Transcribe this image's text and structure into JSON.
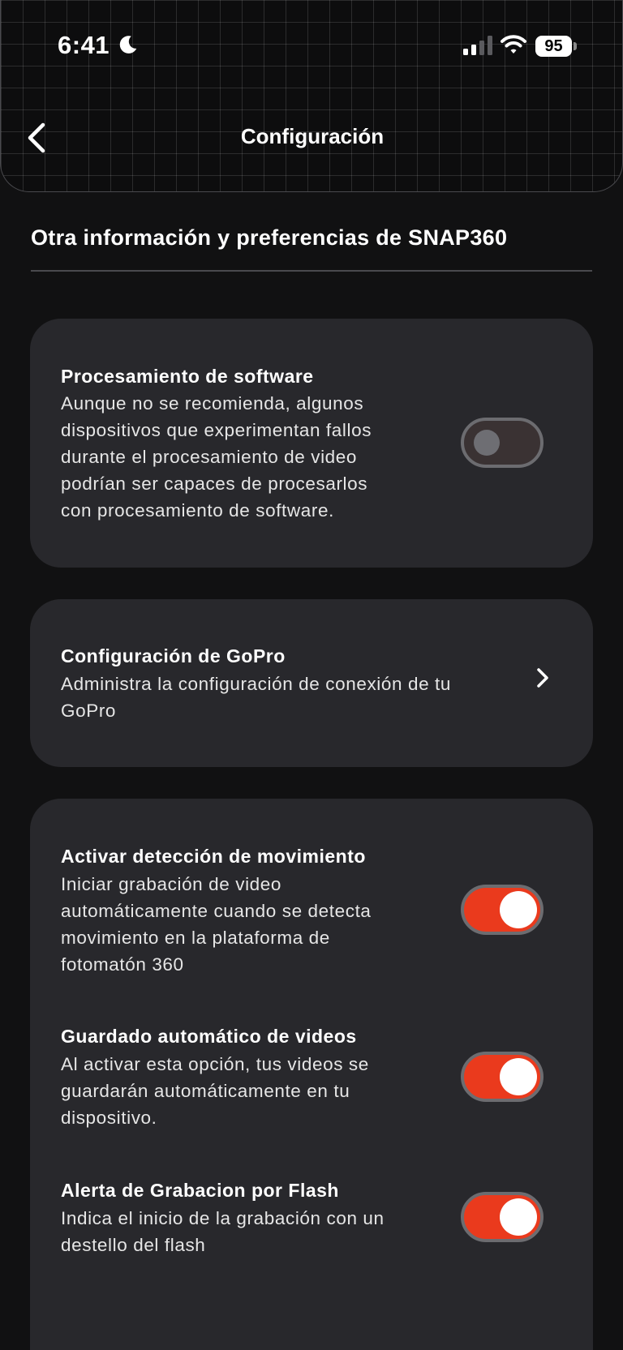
{
  "status_bar": {
    "time": "6:41",
    "battery": "95"
  },
  "header": {
    "title": "Configuración"
  },
  "section": {
    "title": "Otra información y preferencias de SNAP360"
  },
  "software_processing": {
    "title": "Procesamiento de software",
    "desc_lines": [
      "Aunque no se recomienda, algunos",
      "dispositivos que experimentan fallos",
      "durante el procesamiento de video",
      "podrían ser capaces de procesarlos",
      "con procesamiento de software."
    ],
    "enabled": false
  },
  "gopro": {
    "title": "Configuración de GoPro",
    "desc_lines": [
      "Administra la configuración de conexión de tu",
      "GoPro"
    ]
  },
  "motion_detection": {
    "title": "Activar detección de movimiento",
    "desc_lines": [
      "Iniciar grabación de video",
      "automáticamente cuando se detecta",
      "movimiento en la plataforma de",
      "fotomatón 360"
    ],
    "enabled": true
  },
  "autosave": {
    "title": "Guardado automático de videos",
    "desc_lines": [
      "Al activar esta opción, tus videos se",
      "guardarán automáticamente en tu",
      "dispositivo."
    ],
    "enabled": true
  },
  "flash_alert": {
    "title": "Alerta de Grabacion por Flash",
    "desc_lines": [
      "Indica el inicio de la grabación con un",
      "destello del flash"
    ],
    "enabled": true
  },
  "colors": {
    "accent": "#ea3a1d",
    "card": "#28282c",
    "background": "#111112"
  }
}
